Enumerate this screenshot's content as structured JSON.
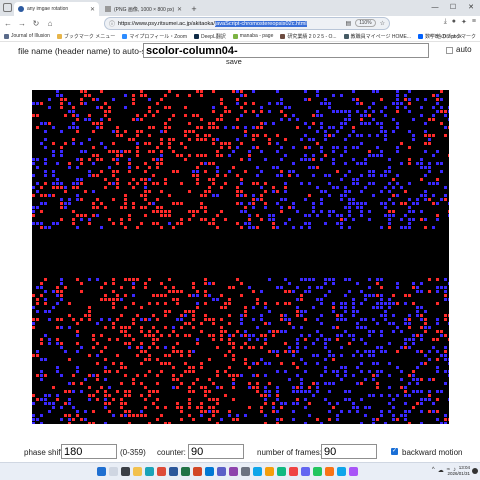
{
  "browser": {
    "tabs": [
      {
        "label": "any imgae rotation",
        "active": true
      },
      {
        "label": "(PNG 画像, 1000 × 800 px)",
        "active": false
      }
    ],
    "url_plain": "https://www.psy.ritsumei.ac.jp/akitaoka/",
    "url_selected": "javaScript-chromostereopsis02c.html",
    "zoom": "110%",
    "bookmarks": [
      {
        "label": "Journal of Illusion",
        "color": "#5a6b8a"
      },
      {
        "label": "ブックマーク メニュー",
        "color": "#e7b54a"
      },
      {
        "label": "マイプロフィール・Zoom",
        "color": "#2d8cff"
      },
      {
        "label": "DeepL翻訳",
        "color": "#0f2b46"
      },
      {
        "label": "manaba - page",
        "color": "#7cb342"
      },
      {
        "label": "研究業績 2 0 2 5 - O...",
        "color": "#6d4c41"
      },
      {
        "label": "教職員マイページ HOME...",
        "color": "#455a64"
      },
      {
        "label": "数学B - Dropbox",
        "color": "#0061fe"
      }
    ],
    "bookmarks_more": "»",
    "bookmarks_other": "他のブックマーク"
  },
  "page": {
    "file_label": "file name (header name) to auto-save",
    "file_value": "scolor-column04-",
    "auto_label": "auto",
    "save_label": "save",
    "controls": {
      "phase_label": "phase shift",
      "phase_value": "180",
      "phase_range": "(0-359)",
      "counter_label": "counter:",
      "counter_value": "90",
      "frames_label": "number of frames:",
      "frames_value": "90",
      "backward_label": "backward motion",
      "backward_checked": true
    }
  },
  "stimulus": {
    "background": "#000000",
    "red": "#ff2a2a",
    "blue": "#3a28ff",
    "gap_band": "black horizontal band across the middle"
  },
  "taskbar": {
    "time": "13:04",
    "date": "2026/01/31"
  }
}
